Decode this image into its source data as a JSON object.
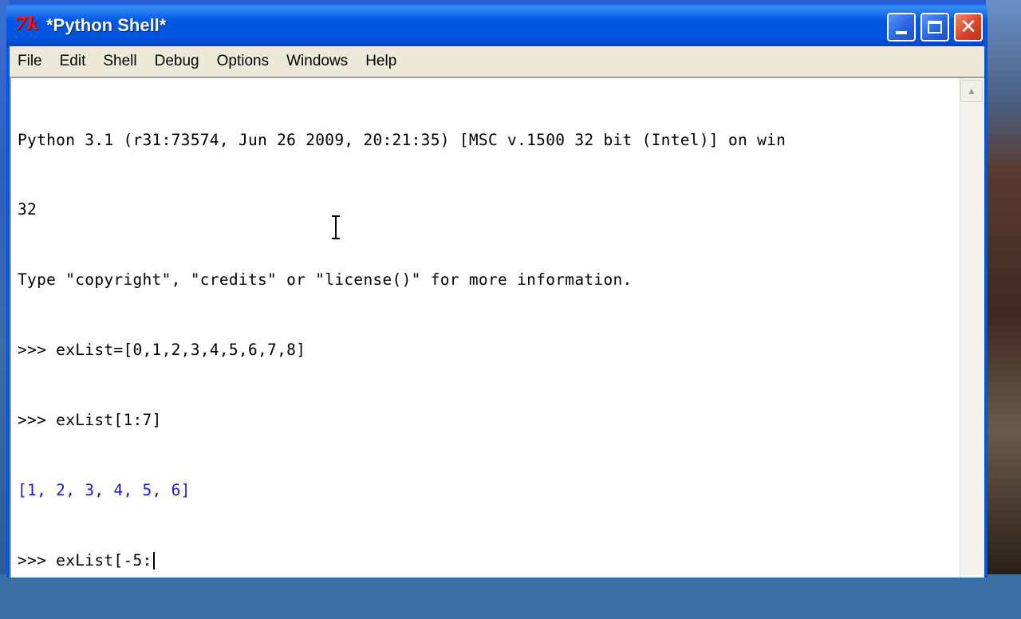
{
  "window": {
    "title": "*Python Shell*",
    "app_icon_text": "7k"
  },
  "title_buttons": {
    "minimize": "minimize-icon",
    "maximize": "maximize-icon",
    "close": "close-icon"
  },
  "menu": {
    "items": [
      "File",
      "Edit",
      "Shell",
      "Debug",
      "Options",
      "Windows",
      "Help"
    ]
  },
  "shell": {
    "lines": [
      {
        "text": "Python 3.1 (r31:73574, Jun 26 2009, 20:21:35) [MSC v.1500 32 bit (Intel)] on win",
        "kind": "banner"
      },
      {
        "text": "32",
        "kind": "banner"
      },
      {
        "text": "Type \"copyright\", \"credits\" or \"license()\" for more information.",
        "kind": "banner"
      },
      {
        "text": ">>> exList=[0,1,2,3,4,5,6,7,8]",
        "kind": "input"
      },
      {
        "text": ">>> exList[1:7]",
        "kind": "input"
      },
      {
        "text": "[1, 2, 3, 4, 5, 6]",
        "kind": "output"
      },
      {
        "text": ">>> exList[-5:",
        "kind": "input-current"
      }
    ]
  },
  "colors": {
    "titlebar": "#0054e3",
    "output_text": "#1a1ad0",
    "menu_bg": "#ece9d8"
  }
}
